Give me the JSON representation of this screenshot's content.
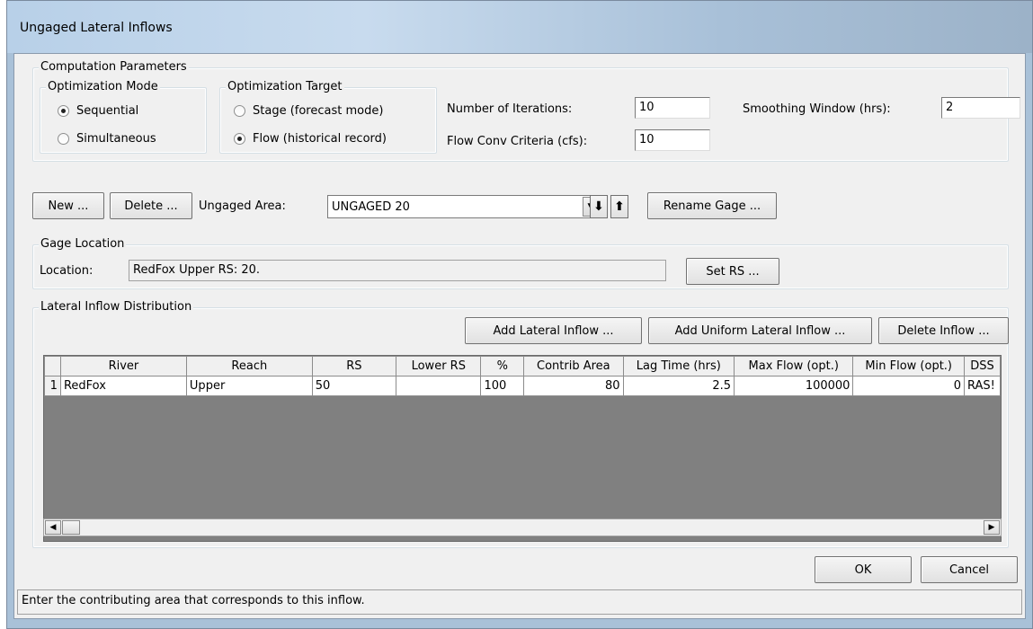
{
  "window": {
    "title": "Ungaged Lateral Inflows"
  },
  "computation": {
    "group_label": "Computation Parameters",
    "opt_mode": {
      "label": "Optimization Mode",
      "options": [
        {
          "label": "Sequential",
          "checked": true
        },
        {
          "label": "Simultaneous",
          "checked": false
        }
      ]
    },
    "opt_target": {
      "label": "Optimization Target",
      "options": [
        {
          "label": "Stage (forecast mode)",
          "checked": false
        },
        {
          "label": "Flow (historical record)",
          "checked": true
        }
      ]
    },
    "iterations_label": "Number of Iterations:",
    "iterations_value": "10",
    "flow_conv_label": "Flow Conv Criteria (cfs):",
    "flow_conv_value": "10",
    "smoothing_label": "Smoothing Window (hrs):",
    "smoothing_value": "2"
  },
  "area_bar": {
    "new_label": "New ...",
    "delete_label": "Delete ...",
    "ungaged_label": "Ungaged Area:",
    "ungaged_value": "UNGAGED 20",
    "rename_label": "Rename Gage ..."
  },
  "gage_location": {
    "group_label": "Gage Location",
    "location_label": "Location:",
    "location_value": "RedFox  Upper  RS: 20.",
    "set_rs_label": "Set RS ..."
  },
  "distribution": {
    "group_label": "Lateral Inflow Distribution",
    "add_label": "Add Lateral Inflow ...",
    "add_uniform_label": "Add Uniform Lateral Inflow ...",
    "delete_label": "Delete Inflow ...",
    "columns": [
      "",
      "River",
      "Reach",
      "RS",
      "Lower RS",
      "%",
      "Contrib Area",
      "Lag Time (hrs)",
      "Max Flow (opt.)",
      "Min Flow (opt.)",
      "DSS"
    ],
    "rows": [
      [
        "1",
        "RedFox",
        "Upper",
        "50",
        "",
        "100",
        "80",
        "2.5",
        "100000",
        "0",
        "RAS!"
      ]
    ]
  },
  "footer": {
    "ok_label": "OK",
    "cancel_label": "Cancel",
    "status_text": "Enter the contributing area that corresponds to this inflow."
  },
  "icons": {
    "down_arrow": "down-arrow-icon",
    "up_arrow": "up-arrow-icon"
  }
}
